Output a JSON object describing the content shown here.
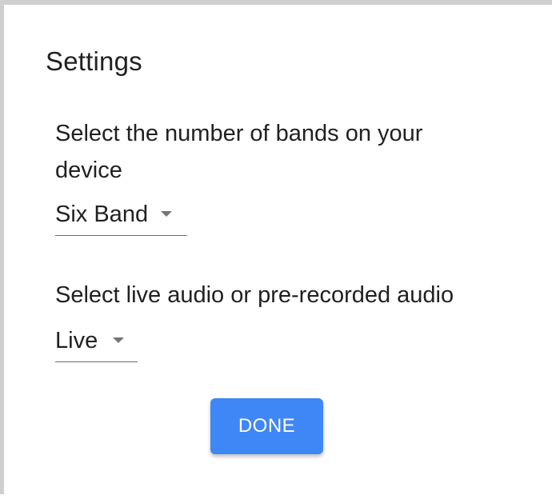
{
  "dialog": {
    "title": "Settings"
  },
  "bands": {
    "label": "Select the number of bands on your device",
    "selected": "Six Band"
  },
  "audio": {
    "label": "Select live audio or pre-recorded audio",
    "selected": "Live"
  },
  "actions": {
    "done_label": "DONE"
  },
  "colors": {
    "primary": "#3f86f7",
    "text": "#212121",
    "frame": "#cfcfcf"
  },
  "icons": {
    "dropdown": "caret-down-icon"
  }
}
